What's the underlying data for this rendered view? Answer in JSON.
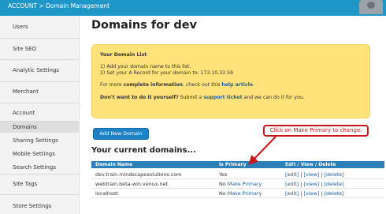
{
  "header": {
    "breadcrumb": "ACCOUNT > Domain Management"
  },
  "sidebar": {
    "items": [
      {
        "label": "Users"
      },
      {
        "label": "Site SEO"
      },
      {
        "label": "Analytic Settings"
      },
      {
        "label": "Merchant"
      },
      {
        "label": "Account"
      },
      {
        "label": "Domains"
      },
      {
        "label": "Sharing Settings"
      },
      {
        "label": "Mobile Settings"
      },
      {
        "label": "Search Settings"
      },
      {
        "label": "Site Tags"
      },
      {
        "label": "Store Settings"
      }
    ]
  },
  "main": {
    "title": "Domains for dev",
    "info": {
      "title": "Your Domain List",
      "step1": "1) Add your domain name to this list.",
      "step2": "2) Set your A Record for your domain to: 173.10.33.59",
      "more_pre": "For more ",
      "more_bold": "complete information",
      "more_mid": ", check out this ",
      "more_link": "help article",
      "more_end": ".",
      "diy_bold": "Don't want to do it yourself?",
      "diy_mid": " Submit a ",
      "diy_link": "support ticket",
      "diy_end": " and we can do it for you."
    },
    "add_button": "Add New Domain",
    "current_heading": "Your current domains...",
    "table": {
      "headers": [
        "Domain Name",
        "Is Primary",
        "Edit / View / Delete"
      ],
      "rows": [
        {
          "domain": "dev.train.mindscapesolutions.com",
          "primary": "Yes",
          "make_primary": "",
          "edit": "[edit]",
          "view": "[view]",
          "delete": "[delete]"
        },
        {
          "domain": "webtrain.beta-win.venux.net",
          "primary": "No",
          "make_primary": "Make Primary",
          "edit": "[edit]",
          "view": "[view]",
          "delete": "[delete]"
        },
        {
          "domain": "localhost",
          "primary": "No",
          "make_primary": "Make Primary",
          "edit": "[edit]",
          "view": "[view]",
          "delete": "[delete]"
        }
      ],
      "separator": "|"
    },
    "callout": "Click on Make Primary to change."
  },
  "colors": {
    "topbar": "#1f96c8",
    "info_box": "#ffe27a",
    "table_header": "#2d7fb8",
    "link": "#1f5e9e",
    "callout": "#c8171a"
  }
}
